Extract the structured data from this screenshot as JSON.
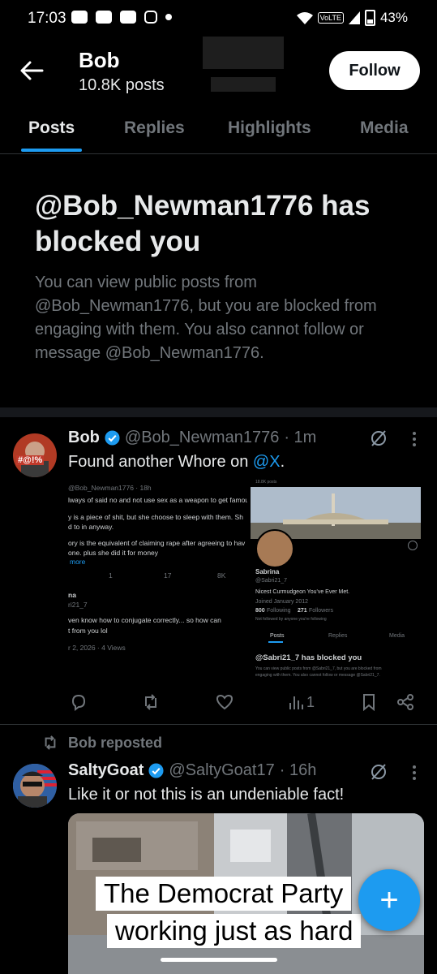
{
  "status_bar": {
    "time": "17:03",
    "network": "VoLTE",
    "battery": "43%"
  },
  "header": {
    "name": "Bob",
    "posts_count": "10.8K posts",
    "follow_label": "Follow"
  },
  "tabs": [
    {
      "label": "Posts",
      "active": true
    },
    {
      "label": "Replies",
      "active": false
    },
    {
      "label": "Highlights",
      "active": false
    },
    {
      "label": "Media",
      "active": false
    }
  ],
  "blocked": {
    "title": "@Bob_Newman1776 has blocked you",
    "text": "You can view public posts from @Bob_Newman1776, but you are blocked from engaging with them. You also cannot follow or message @Bob_Newman1776."
  },
  "post1": {
    "name": "Bob",
    "handle": "@Bob_Newman1776",
    "time": "· 1m",
    "text_prefix": "Found another Whore on ",
    "text_link": "@X",
    "text_suffix": ".",
    "avatar_text": "#@!%",
    "views": "1",
    "embedded": {
      "left": {
        "handle_line": "@Bob_Newman1776 · 18h",
        "lines": [
          "lways of said no and not use sex as a weapon to get famou",
          "y is a piece of shit, but she choose to sleep with them. Sh",
          "d to in anyway.",
          "ory is the equivalent of claiming rape after agreeing to hav",
          "one.  plus she did it for money"
        ],
        "more": "more",
        "reply_name": "na",
        "reply_handle": "ri21_7",
        "reply_lines": [
          "ven know how to conjugate correctly... so how can",
          "t from you lol"
        ],
        "reply_meta": "r 2, 2026 · 4 Views",
        "counts": [
          "1",
          "17",
          "8K"
        ]
      },
      "right": {
        "top_label": "18.8K posts",
        "name": "Sabrina",
        "handle": "@Sabri21_7",
        "bio": "Nicest Curmudgeon You've Ever Met.",
        "joined": "Joined January 2012",
        "following": "800",
        "following_label": "Following",
        "followers": "271",
        "followers_label": "Followers",
        "not_followed": "Not followed by anyone you're following",
        "tabs": [
          "Posts",
          "Replies",
          "Media"
        ],
        "blocked_title": "@Sabri21_7 has blocked you",
        "blocked_text_1": "You can view public posts from @Sabri21_7, but you are blocked from",
        "blocked_text_2": "engaging with them. You also cannot follow or message @Sabri21_7."
      }
    }
  },
  "repost": {
    "label": "Bob reposted",
    "name": "SaltyGoat",
    "handle": "@SaltyGoat17",
    "time": "· 16h",
    "text": "Like it or not this is an undeniable fact!",
    "caption_1": "The Democrat Party",
    "caption_2": "working just as hard"
  },
  "fab": {
    "symbol": "+"
  },
  "colors": {
    "accent": "#1d9bf0",
    "background": "#000000",
    "muted": "#71767b",
    "text": "#e7e9ea"
  }
}
